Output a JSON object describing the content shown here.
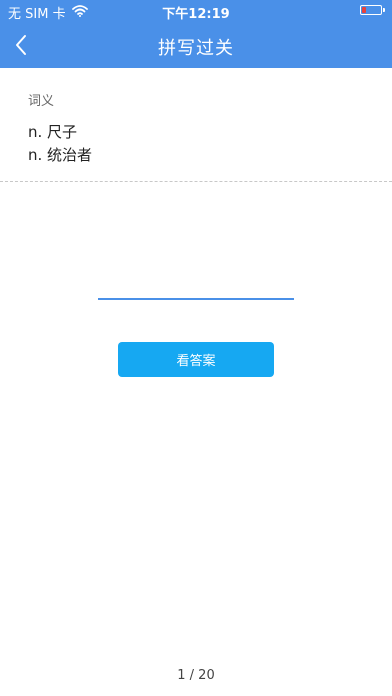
{
  "status_bar": {
    "carrier": "无 SIM 卡",
    "time": "下午12:19",
    "battery_color": "#e8423a"
  },
  "nav": {
    "title": "拼写过关",
    "back_icon": "chevron-left-icon",
    "color": "#4a90e8"
  },
  "meaning": {
    "label": "词义",
    "lines": [
      "n. 尺子",
      "n. 统治者"
    ]
  },
  "answer_input": {
    "value": "",
    "placeholder": ""
  },
  "show_answer_button": {
    "label": "看答案",
    "color": "#16a8f2"
  },
  "pagination": {
    "text": "1 / 20"
  }
}
